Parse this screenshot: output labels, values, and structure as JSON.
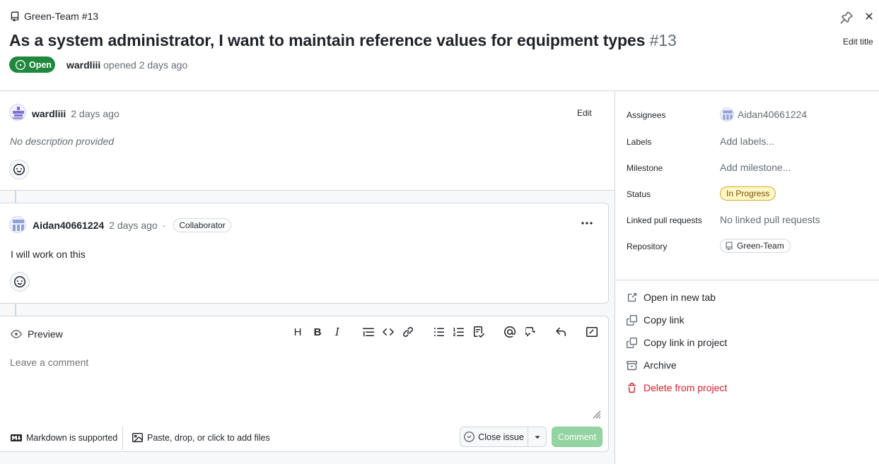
{
  "header": {
    "repo_crumb": "Green-Team #13",
    "title": "As a system administrator, I want to maintain reference values for equipment types",
    "issue_number": "#13",
    "state": "Open",
    "author": "wardliii",
    "opened_text": "opened 2 days ago",
    "edit_title": "Edit title"
  },
  "description": {
    "author": "wardliii",
    "time": "2 days ago",
    "edit_label": "Edit",
    "body": "No description provided"
  },
  "comment": {
    "author": "Aidan40661224",
    "time": "2 days ago",
    "separator": "·",
    "role": "Collaborator",
    "body": "I will work on this"
  },
  "editor": {
    "preview_label": "Preview",
    "placeholder": "Leave a comment",
    "markdown_note": "Markdown is supported",
    "attach_note": "Paste, drop, or click to add files",
    "close_issue_label": "Close issue",
    "comment_label": "Comment"
  },
  "sidebar": {
    "fields": {
      "assignees_label": "Assignees",
      "assignees_value": "Aidan40661224",
      "labels_label": "Labels",
      "labels_value": "Add labels...",
      "milestone_label": "Milestone",
      "milestone_value": "Add milestone...",
      "status_label": "Status",
      "status_value": "In Progress",
      "linked_label": "Linked pull requests",
      "linked_value": "No linked pull requests",
      "repository_label": "Repository",
      "repository_value": "Green-Team"
    },
    "actions": {
      "open_new_tab": "Open in new tab",
      "copy_link": "Copy link",
      "copy_link_project": "Copy link in project",
      "archive": "Archive",
      "delete": "Delete from project"
    }
  },
  "colors": {
    "open_green": "#1f883d",
    "comment_btn_disabled": "#94d3a2",
    "danger": "#cf222e",
    "status_bg": "#fff8c5"
  }
}
